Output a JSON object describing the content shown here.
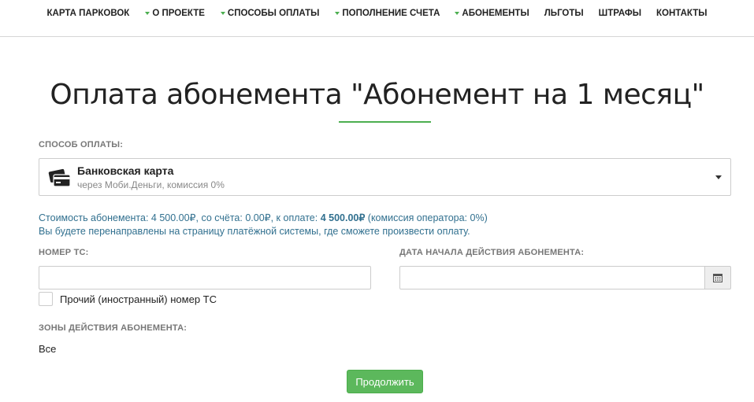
{
  "nav": {
    "items": [
      {
        "label": "КАРТА ПАРКОВОК",
        "caret": false
      },
      {
        "label": "О ПРОЕКТЕ",
        "caret": true
      },
      {
        "label": "СПОСОБЫ ОПЛАТЫ",
        "caret": true
      },
      {
        "label": "ПОПОЛНЕНИЕ СЧЕТА",
        "caret": true
      },
      {
        "label": "АБОНЕМЕНТЫ",
        "caret": true
      },
      {
        "label": "ЛЬГОТЫ",
        "caret": false
      },
      {
        "label": "ШТРАФЫ",
        "caret": false
      },
      {
        "label": "КОНТАКТЫ",
        "caret": false
      }
    ]
  },
  "page": {
    "title": "Оплата абонемента \"Абонемент на 1 месяц\""
  },
  "payment": {
    "label": "СПОСОБ ОПЛАТЫ:",
    "method_title": "Банковская карта",
    "method_subtitle": "через Моби.Деньги, комиссия 0%",
    "icon": "credit-card-icon"
  },
  "info": {
    "cost_prefix": "Стоимость абонемента: 4 500.00₽, со счёта: 0.00₽, к оплате: ",
    "cost_total": "4 500.00₽",
    "cost_suffix": " (комиссия оператора: 0%)",
    "redirect_note": "Вы будете перенаправлены на страницу платёжной системы, где сможете произвести оплату."
  },
  "form": {
    "plate_label": "НОМЕР ТС:",
    "plate_value": "",
    "start_date_label": "ДАТА НАЧАЛА ДЕЙСТВИЯ АБОНЕМЕНТА:",
    "start_date_value": "",
    "foreign_plate_label": "Прочий (иностранный) номер ТС",
    "foreign_plate_checked": false,
    "zones_label": "ЗОНЫ ДЕЙСТВИЯ АБОНЕМЕНТА:",
    "zones_value": "Все"
  },
  "actions": {
    "continue_label": "Продолжить"
  },
  "colors": {
    "accent_green": "#4caf50",
    "button_green": "#5cb85c",
    "info_blue": "#31708f"
  }
}
